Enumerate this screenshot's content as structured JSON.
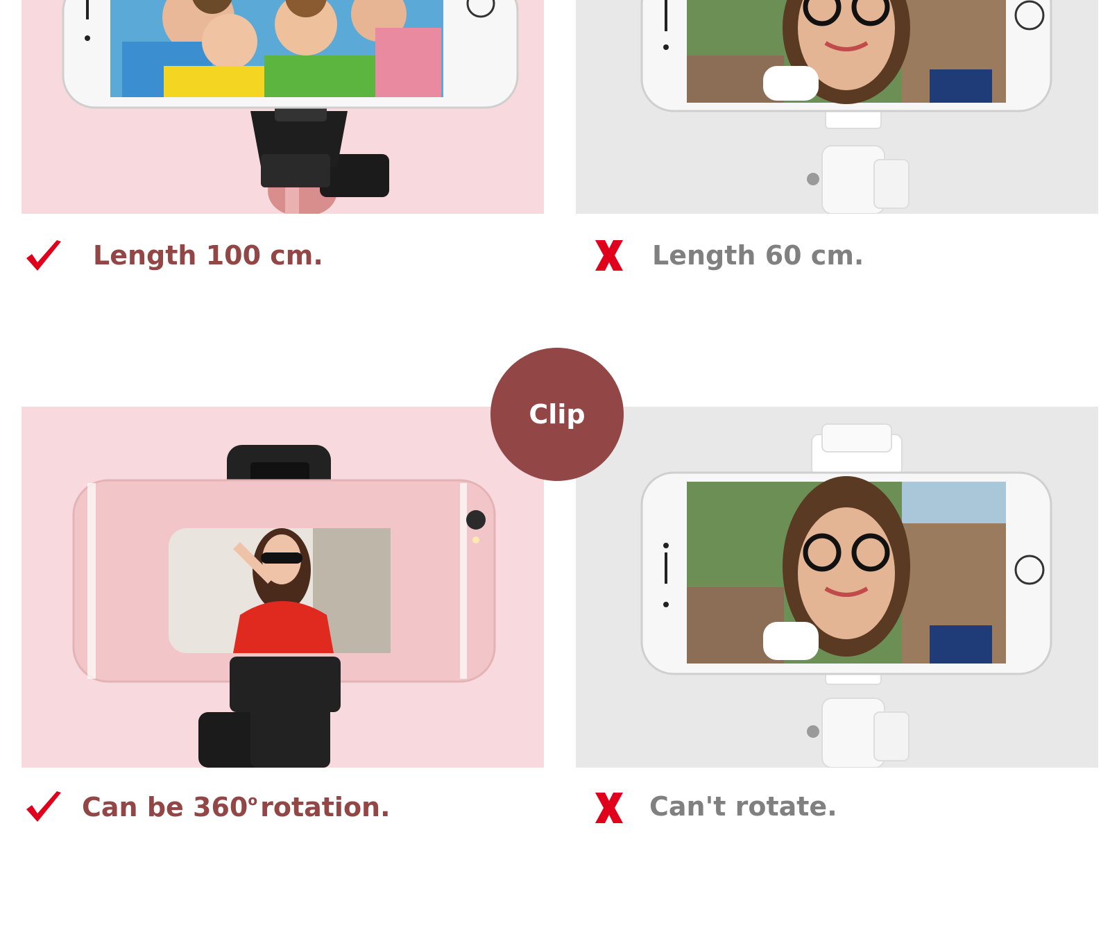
{
  "colors": {
    "pink_panel": "#f8d9de",
    "gray_panel": "#e8e8e8",
    "good_text": "#924646",
    "bad_text": "#808080",
    "mark_red": "#e0001b",
    "badge": "#924646"
  },
  "top_row": {
    "good": {
      "icon": "check-mark-icon",
      "caption": "Length 100 cm."
    },
    "bad": {
      "icon": "x-mark-icon",
      "caption": "Length 60 cm."
    }
  },
  "badge": {
    "label": "Clip"
  },
  "bottom_row": {
    "good": {
      "icon": "check-mark-icon",
      "caption_pre": "Can be 360",
      "caption_sup": "o",
      "caption_post": "rotation."
    },
    "bad": {
      "icon": "x-mark-icon",
      "caption": "Can't rotate."
    }
  }
}
